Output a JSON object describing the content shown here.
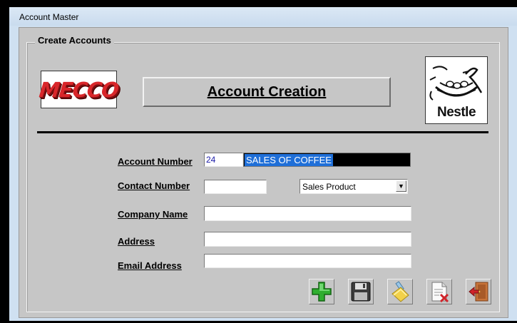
{
  "window": {
    "title": "Account Master"
  },
  "group": {
    "label": "Create Accounts"
  },
  "logos": {
    "left_brand": "MECCO",
    "right_brand": "Nestle"
  },
  "header": {
    "title": "Account Creation"
  },
  "form": {
    "account_number_label": "Account Number",
    "account_number_value": "24",
    "account_name_value": "SALES OF COFFEE",
    "contact_number_label": "Contact Number",
    "contact_number_value": "",
    "account_type_value": "Sales Product",
    "company_name_label": "Company Name",
    "company_name_value": "",
    "address_label": "Address",
    "address_value": "",
    "email_label": "Email Address",
    "email_value": ""
  },
  "toolbar": {
    "icons": [
      "add-icon",
      "save-icon",
      "clear-icon",
      "delete-icon",
      "exit-icon"
    ]
  },
  "colors": {
    "client_bg": "#c6c6c6",
    "selection": "#1f6fd8",
    "add_green": "#2fae2f",
    "exit_orange": "#c8743a"
  }
}
